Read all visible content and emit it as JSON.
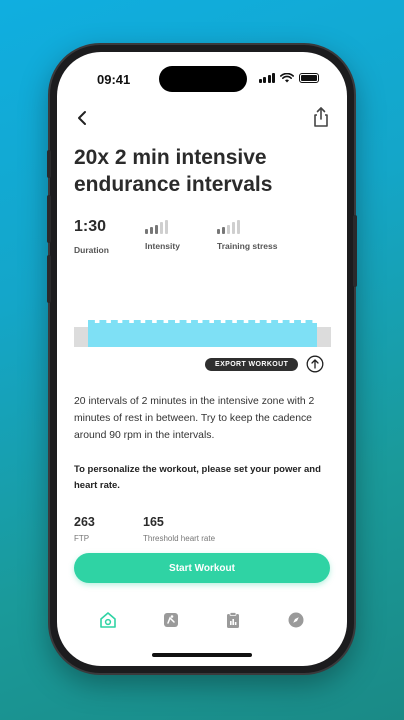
{
  "status_bar": {
    "time": "09:41"
  },
  "workout": {
    "title": "20x 2 min intensive endurance intervals",
    "duration_value": "1:30",
    "duration_label": "Duration",
    "intensity_label": "Intensity",
    "intensity_level": 3,
    "training_stress_label": "Training stress",
    "training_stress_level": 2,
    "level_max": 5,
    "export_label": "EXPORT WORKOUT",
    "description": "20 intervals of 2 minutes in the intensive zone with 2 minutes of rest in between. Try to keep the cadence around 90 rpm in the intervals.",
    "personalize_text": "To personalize the workout, please set your power and heart rate.",
    "ftp_value": "263",
    "ftp_label": "FTP",
    "hr_value": "165",
    "hr_label": "Threshold heart rate",
    "start_label": "Start Workout"
  },
  "chart_data": {
    "type": "bar",
    "description_type": "workout-profile",
    "warmup": 1,
    "intervals": 20,
    "cooldown": 1,
    "colors": {
      "rest": "#dcdcdc",
      "work": "#7ee0f5"
    }
  },
  "tab_bar": {
    "items": [
      {
        "icon": "home-icon",
        "active": true
      },
      {
        "icon": "workouts-icon",
        "active": false
      },
      {
        "icon": "plan-icon",
        "active": false
      },
      {
        "icon": "explore-icon",
        "active": false
      }
    ]
  },
  "colors": {
    "accent": "#2fd3a4",
    "text": "#2b2b2b",
    "bar_active": "#777777",
    "bar_inactive": "#cfcfcf"
  }
}
